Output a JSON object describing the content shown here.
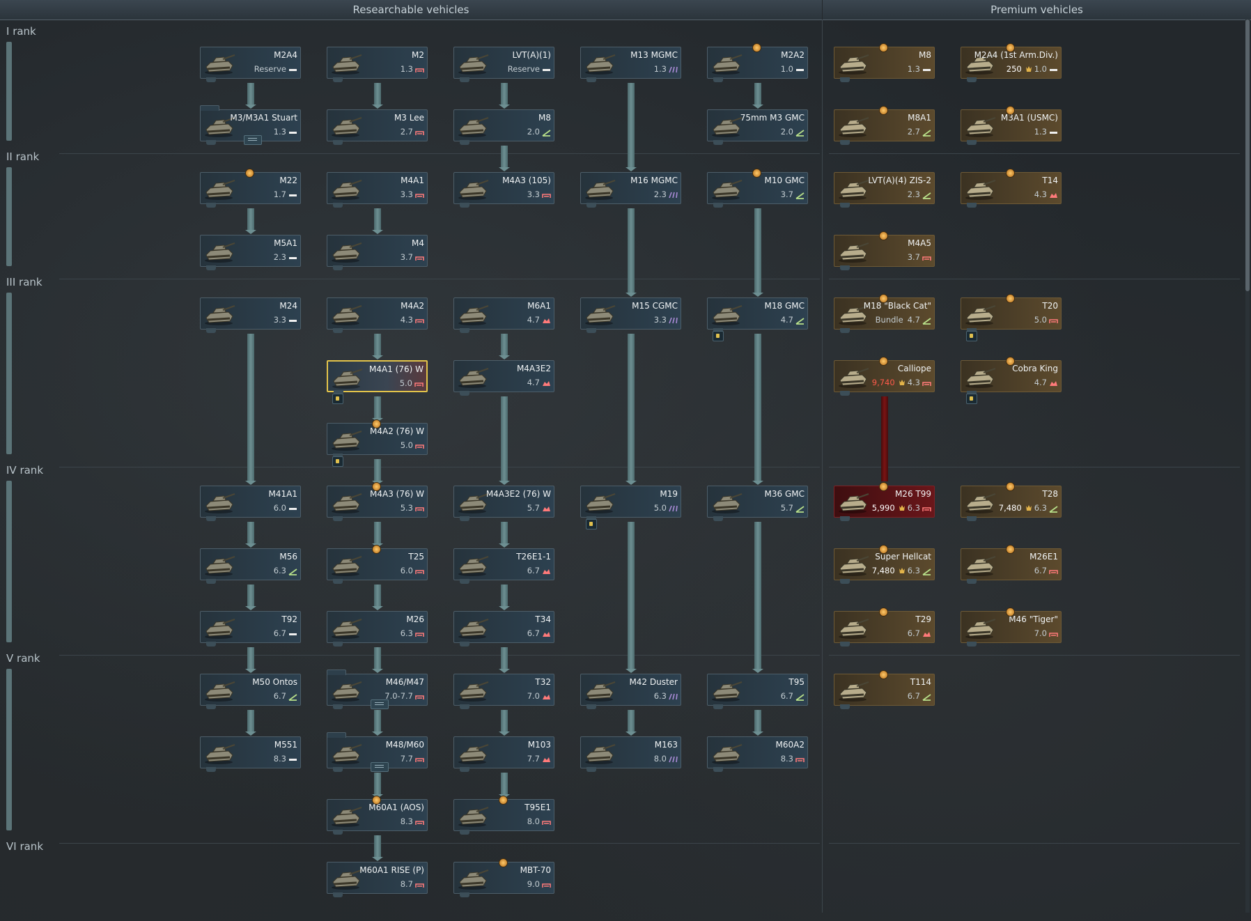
{
  "headers": {
    "researchable": "Researchable vehicles",
    "premium": "Premium vehicles"
  },
  "ranks": [
    "I rank",
    "II rank",
    "III rank",
    "IV rank",
    "V rank",
    "VI rank"
  ],
  "colors": {
    "spaa": "#a98bd6",
    "tank": "#ff7a7a",
    "td": "#b8e08a",
    "light": "#f0f0f0"
  },
  "vehicles": [
    {
      "id": "m2a4",
      "name": "M2A4",
      "br": "Reserve",
      "cls": "light",
      "col": 0,
      "row": 0
    },
    {
      "id": "m2",
      "name": "M2",
      "br": "1.3",
      "cls": "tank",
      "col": 1,
      "row": 0
    },
    {
      "id": "lvta1",
      "name": "LVT(A)(1)",
      "br": "Reserve",
      "cls": "light",
      "col": 2,
      "row": 0
    },
    {
      "id": "m13",
      "name": "M13 MGMC",
      "br": "1.3",
      "cls": "spaa",
      "col": 3,
      "row": 0
    },
    {
      "id": "m2a2",
      "name": "M2A2",
      "br": "1.0",
      "cls": "light",
      "col": 4,
      "row": 0,
      "top": true
    },
    {
      "id": "m3stuart",
      "name": "M3/M3A1 Stuart",
      "br": "1.3",
      "cls": "light",
      "col": 0,
      "row": 1,
      "group": true
    },
    {
      "id": "m3lee",
      "name": "M3 Lee",
      "br": "2.7",
      "cls": "tank",
      "col": 1,
      "row": 1
    },
    {
      "id": "m8",
      "name": "M8",
      "br": "2.0",
      "cls": "td",
      "col": 2,
      "row": 1
    },
    {
      "id": "m3gmc",
      "name": "75mm M3 GMC",
      "br": "2.0",
      "cls": "td",
      "col": 4,
      "row": 1
    },
    {
      "id": "m22",
      "name": "M22",
      "br": "1.7",
      "cls": "light",
      "col": 0,
      "row": 2,
      "top": true
    },
    {
      "id": "m4a1",
      "name": "M4A1",
      "br": "3.3",
      "cls": "tank",
      "col": 1,
      "row": 2
    },
    {
      "id": "m4a3105",
      "name": "M4A3 (105)",
      "br": "3.3",
      "cls": "tank",
      "col": 2,
      "row": 2
    },
    {
      "id": "m16",
      "name": "M16 MGMC",
      "br": "2.3",
      "cls": "spaa",
      "col": 3,
      "row": 2
    },
    {
      "id": "m10",
      "name": "M10 GMC",
      "br": "3.7",
      "cls": "td",
      "col": 4,
      "row": 2,
      "top": true
    },
    {
      "id": "m5a1",
      "name": "M5A1",
      "br": "2.3",
      "cls": "light",
      "col": 0,
      "row": 3
    },
    {
      "id": "m4",
      "name": "M4",
      "br": "3.7",
      "cls": "tank",
      "col": 1,
      "row": 3
    },
    {
      "id": "m24",
      "name": "M24",
      "br": "3.3",
      "cls": "light",
      "col": 0,
      "row": 4
    },
    {
      "id": "m4a2",
      "name": "M4A2",
      "br": "4.3",
      "cls": "tank",
      "col": 1,
      "row": 4
    },
    {
      "id": "m6a1",
      "name": "M6A1",
      "br": "4.7",
      "cls": "heavy",
      "col": 2,
      "row": 4
    },
    {
      "id": "m15",
      "name": "M15 CGMC",
      "br": "3.3",
      "cls": "spaa",
      "col": 3,
      "row": 4
    },
    {
      "id": "m18",
      "name": "M18 GMC",
      "br": "4.7",
      "cls": "td",
      "col": 4,
      "row": 4,
      "key": true
    },
    {
      "id": "m4a176",
      "name": "M4A1 (76) W",
      "br": "5.0",
      "cls": "tank",
      "col": 1,
      "row": 5,
      "sel": true,
      "key": true
    },
    {
      "id": "m4a3e2",
      "name": "M4A3E2",
      "br": "4.7",
      "cls": "heavy",
      "col": 2,
      "row": 5
    },
    {
      "id": "m4a276",
      "name": "M4A2 (76) W",
      "br": "5.0",
      "cls": "tank",
      "col": 1,
      "row": 6,
      "top": true,
      "key": true
    },
    {
      "id": "m41a1",
      "name": "M41A1",
      "br": "6.0",
      "cls": "light",
      "col": 0,
      "row": 7
    },
    {
      "id": "m4a376",
      "name": "M4A3 (76) W",
      "br": "5.3",
      "cls": "tank",
      "col": 1,
      "row": 7,
      "top": true
    },
    {
      "id": "m4a3e276",
      "name": "M4A3E2 (76) W",
      "br": "5.7",
      "cls": "heavy",
      "col": 2,
      "row": 7
    },
    {
      "id": "m19",
      "name": "M19",
      "br": "5.0",
      "cls": "spaa",
      "col": 3,
      "row": 7,
      "key": true
    },
    {
      "id": "m36",
      "name": "M36 GMC",
      "br": "5.7",
      "cls": "td",
      "col": 4,
      "row": 7
    },
    {
      "id": "m56",
      "name": "M56",
      "br": "6.3",
      "cls": "td",
      "col": 0,
      "row": 8
    },
    {
      "id": "t25",
      "name": "T25",
      "br": "6.0",
      "cls": "tank",
      "col": 1,
      "row": 8,
      "top": true
    },
    {
      "id": "t26e1",
      "name": "T26E1-1",
      "br": "6.7",
      "cls": "heavy",
      "col": 2,
      "row": 8
    },
    {
      "id": "t92",
      "name": "T92",
      "br": "6.7",
      "cls": "light",
      "col": 0,
      "row": 9
    },
    {
      "id": "m26",
      "name": "M26",
      "br": "6.3",
      "cls": "tank",
      "col": 1,
      "row": 9
    },
    {
      "id": "t34",
      "name": "T34",
      "br": "6.7",
      "cls": "heavy",
      "col": 2,
      "row": 9
    },
    {
      "id": "m50",
      "name": "M50 Ontos",
      "br": "6.7",
      "cls": "td",
      "col": 0,
      "row": 10
    },
    {
      "id": "m46",
      "name": "M46/M47",
      "br": "7.0-7.7",
      "cls": "tank",
      "col": 1,
      "row": 10,
      "group": true
    },
    {
      "id": "t32",
      "name": "T32",
      "br": "7.0",
      "cls": "heavy",
      "col": 2,
      "row": 10
    },
    {
      "id": "m42",
      "name": "M42 Duster",
      "br": "6.3",
      "cls": "spaa",
      "col": 3,
      "row": 10
    },
    {
      "id": "t95",
      "name": "T95",
      "br": "6.7",
      "cls": "td",
      "col": 4,
      "row": 10
    },
    {
      "id": "m551",
      "name": "M551",
      "br": "8.3",
      "cls": "light",
      "col": 0,
      "row": 11
    },
    {
      "id": "m48",
      "name": "M48/M60",
      "br": "7.7",
      "cls": "tank",
      "col": 1,
      "row": 11,
      "group": true
    },
    {
      "id": "m103",
      "name": "M103",
      "br": "7.7",
      "cls": "heavy",
      "col": 2,
      "row": 11
    },
    {
      "id": "m163",
      "name": "M163",
      "br": "8.0",
      "cls": "spaa",
      "col": 3,
      "row": 11
    },
    {
      "id": "m60a2",
      "name": "M60A2",
      "br": "8.3",
      "cls": "tank",
      "col": 4,
      "row": 11
    },
    {
      "id": "m60aos",
      "name": "M60A1 (AOS)",
      "br": "8.3",
      "cls": "tank",
      "col": 1,
      "row": 12,
      "top": true
    },
    {
      "id": "t95e1",
      "name": "T95E1",
      "br": "8.0",
      "cls": "tank",
      "col": 2,
      "row": 12,
      "top": true
    },
    {
      "id": "m60rise",
      "name": "M60A1 RISE (P)",
      "br": "8.7",
      "cls": "tank",
      "col": 1,
      "row": 13
    },
    {
      "id": "mbt70",
      "name": "MBT-70",
      "br": "9.0",
      "cls": "tank",
      "col": 2,
      "row": 13,
      "top": true
    }
  ],
  "premium": [
    {
      "id": "pm8",
      "name": "M8",
      "br": "1.3",
      "cls": "light",
      "col": 5,
      "row": 0,
      "top": true
    },
    {
      "id": "pm2a4",
      "name": "M2A4 (1st Arm.Div.)",
      "br": "1.0",
      "cost": "250",
      "cls": "light",
      "col": 6,
      "row": 0,
      "top": true
    },
    {
      "id": "pm8a1",
      "name": "M8A1",
      "br": "2.7",
      "cls": "td",
      "col": 5,
      "row": 1,
      "top": true
    },
    {
      "id": "pm3a1",
      "name": "M3A1 (USMC)",
      "br": "1.3",
      "cls": "light",
      "col": 6,
      "row": 1,
      "top": true
    },
    {
      "id": "plvt",
      "name": "LVT(A)(4) ZIS-2",
      "br": "2.3",
      "cls": "td",
      "col": 5,
      "row": 2
    },
    {
      "id": "pt14",
      "name": "T14",
      "br": "4.3",
      "cls": "heavy",
      "col": 6,
      "row": 2,
      "top": true
    },
    {
      "id": "pm4a5",
      "name": "M4A5",
      "br": "3.7",
      "cls": "tank",
      "col": 5,
      "row": 3,
      "top": true
    },
    {
      "id": "pm18",
      "name": "M18 \"Black Cat\"",
      "br": "4.7",
      "res": "Bundle",
      "cls": "td",
      "col": 5,
      "row": 4,
      "top": true
    },
    {
      "id": "pt20",
      "name": "T20",
      "br": "5.0",
      "cls": "tank",
      "col": 6,
      "row": 4,
      "top": true,
      "key": true
    },
    {
      "id": "pcall",
      "name": "Calliope",
      "br": "4.3",
      "cost": "9,740",
      "costRed": true,
      "cls": "tank",
      "col": 5,
      "row": 5,
      "top": true
    },
    {
      "id": "pcobra",
      "name": "Cobra King",
      "br": "4.7",
      "cls": "heavy",
      "col": 6,
      "row": 5,
      "top": true,
      "key": true
    },
    {
      "id": "pm26t99",
      "name": "M26 T99",
      "br": "6.3",
      "cost": "5,990",
      "cls": "tank",
      "col": 5,
      "row": 7,
      "top": true,
      "red": true
    },
    {
      "id": "pt28",
      "name": "T28",
      "br": "6.3",
      "cost": "7,480",
      "cls": "td",
      "col": 6,
      "row": 7,
      "top": true
    },
    {
      "id": "phell",
      "name": "Super Hellcat",
      "br": "6.3",
      "cost": "7,480",
      "cls": "td",
      "col": 5,
      "row": 8,
      "top": true
    },
    {
      "id": "pm26e1",
      "name": "M26E1",
      "br": "6.7",
      "cls": "tank",
      "col": 6,
      "row": 8,
      "top": true
    },
    {
      "id": "pt29",
      "name": "T29",
      "br": "6.7",
      "cls": "heavy",
      "col": 5,
      "row": 9,
      "top": true
    },
    {
      "id": "pm46t",
      "name": "M46 \"Tiger\"",
      "br": "7.0",
      "cls": "tank",
      "col": 6,
      "row": 9,
      "top": true
    },
    {
      "id": "pt114",
      "name": "T114",
      "br": "6.7",
      "cls": "td",
      "col": 5,
      "row": 10,
      "top": true
    }
  ]
}
